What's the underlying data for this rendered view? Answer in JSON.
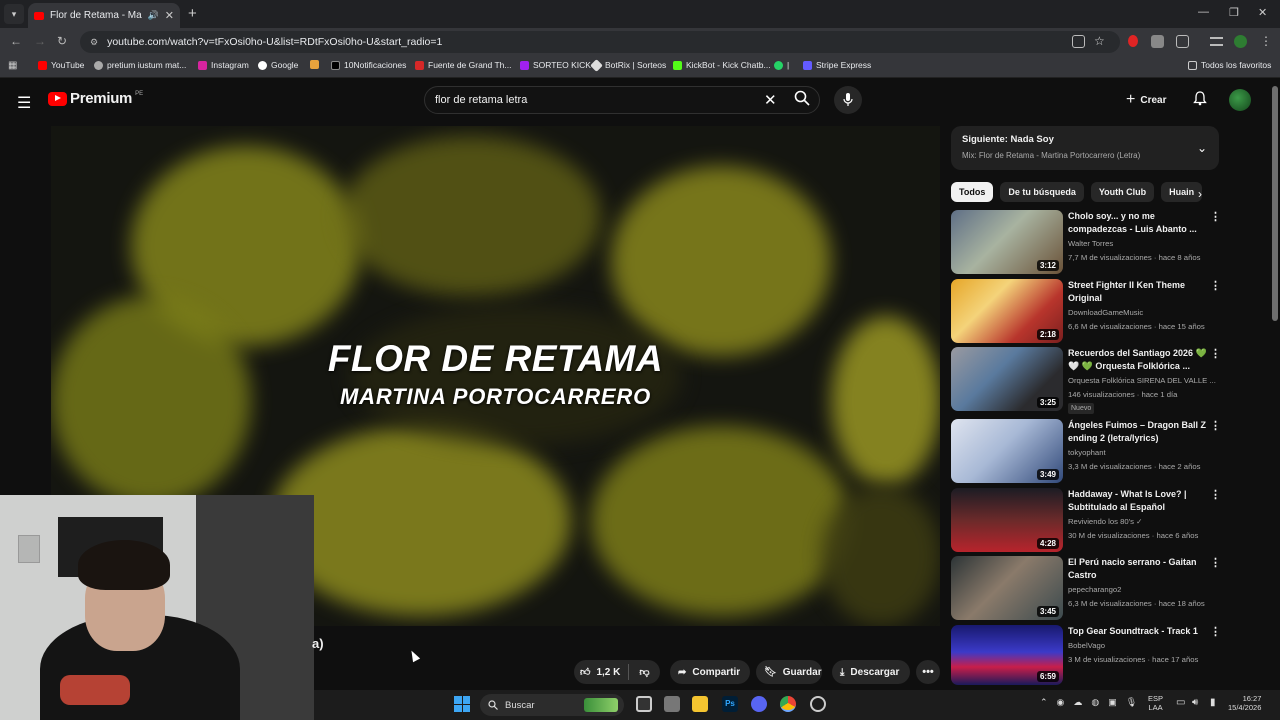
{
  "browser": {
    "tab_title": "Flor de Retama - Martina Pr",
    "url": "youtube.com/watch?v=tFxOsi0ho-U&list=RDtFxOsi0ho-U&start_radio=1",
    "bookmarks": [
      "YouTube",
      "pretium iustum mat...",
      "Instagram",
      "Google",
      "10Notificaciones",
      "Fuente de Grand Th...",
      "SORTEO KICK",
      "BotRix | Sorteos",
      "KickBot - Kick Chatb...",
      "|",
      "Stripe Express"
    ],
    "all_favorites": "Todos los favoritos"
  },
  "youtube": {
    "logo": "Premium",
    "region": "PE",
    "search_value": "flor de retama letra",
    "create_label": "Crear"
  },
  "video": {
    "line1": "FLOR DE RETAMA",
    "line2": "MARTINA PORTOCARRERO",
    "title_fragment": "a)"
  },
  "actions": {
    "likes": "1,2 K",
    "share": "Compartir",
    "save": "Guardar",
    "download": "Descargar"
  },
  "sidebar": {
    "up_next": "Siguiente: Nada Soy",
    "mix": "Mix: Flor de Retama - Martina Portocarrero (Letra)",
    "chips": [
      "Todos",
      "De tu búsqueda",
      "Youth Club",
      "Huain"
    ],
    "videos": [
      {
        "title": "Cholo soy... y no me compadezcas - Luis Abanto ...",
        "channel": "Walter Torres",
        "meta": "7,7 M de visualizaciones · hace 8 años",
        "duration": "3:12"
      },
      {
        "title": "Street Fighter II Ken Theme Original",
        "channel": "DownloadGameMusic",
        "meta": "6,6 M de visualizaciones · hace 15 años",
        "duration": "2:18"
      },
      {
        "title": "Recuerdos del Santiago 2026 💚 🤍 💚 Orquesta Folklórica ...",
        "channel": "Orquesta Folklórica SIRENA DEL VALLE ...",
        "meta": "146 visualizaciones · hace 1 día",
        "badge": "Nuevo",
        "duration": "3:25"
      },
      {
        "title": "Ángeles Fuimos – Dragon Ball Z ending 2 (letra/lyrics)",
        "channel": "tokyophant",
        "meta": "3,3 M de visualizaciones · hace 2 años",
        "duration": "3:49"
      },
      {
        "title": "Haddaway - What Is Love? | Subtitulado al Español",
        "channel": "Reviviendo los 80's ✓",
        "meta": "30 M de visualizaciones · hace 6 años",
        "duration": "4:28"
      },
      {
        "title": "El Perú nacio serrano - Gaitan Castro",
        "channel": "pepecharango2",
        "meta": "6,3 M de visualizaciones · hace 18 años",
        "duration": "3:45"
      },
      {
        "title": "Top Gear Soundtrack - Track 1",
        "channel": "BobelVago",
        "meta": "3 M de visualizaciones · hace 17 años",
        "duration": "6:59"
      }
    ]
  },
  "taskbar": {
    "search": "Buscar",
    "lang1": "ESP",
    "lang2": "LAA",
    "time": "16:27",
    "date": "15/4/2026"
  }
}
